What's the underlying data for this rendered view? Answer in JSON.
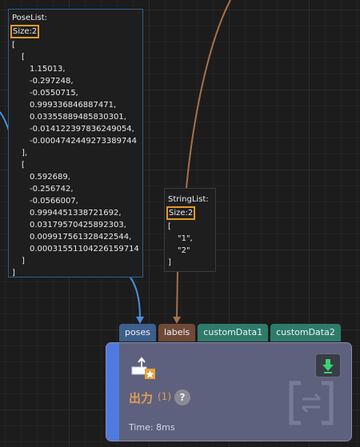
{
  "pose_tooltip": {
    "title": "PoseList:",
    "size": "Size:2",
    "lines": [
      {
        "text": "[",
        "level": 0
      },
      {
        "text": "[",
        "level": 1
      },
      {
        "text": "1.15013,",
        "level": 2
      },
      {
        "text": "-0.297248,",
        "level": 2
      },
      {
        "text": "-0.0550715,",
        "level": 2
      },
      {
        "text": "0.999336846887471,",
        "level": 2
      },
      {
        "text": "0.03355889485830301,",
        "level": 2
      },
      {
        "text": "-0.014122397836249054,",
        "level": 2
      },
      {
        "text": "-0.0004742449273389744",
        "level": 2
      },
      {
        "text": "],",
        "level": 1
      },
      {
        "text": "[",
        "level": 1
      },
      {
        "text": "0.592689,",
        "level": 2
      },
      {
        "text": "-0.256742,",
        "level": 2
      },
      {
        "text": "-0.0566007,",
        "level": 2
      },
      {
        "text": "0.9994451338721692,",
        "level": 2
      },
      {
        "text": "0.03179570425892303,",
        "level": 2
      },
      {
        "text": "0.009917561328422544,",
        "level": 2
      },
      {
        "text": "0.00031551104226159714",
        "level": 2
      },
      {
        "text": "]",
        "level": 1
      },
      {
        "text": "]",
        "level": 0
      }
    ]
  },
  "string_tooltip": {
    "title": "StringList:",
    "size": "Size:2",
    "lines": [
      {
        "text": "[",
        "level": 0
      },
      {
        "text": "\"1\",",
        "level": 3
      },
      {
        "text": "\"2\"",
        "level": 3
      },
      {
        "text": "]",
        "level": 0
      }
    ]
  },
  "ports": [
    {
      "label": "poses",
      "color": "#3d5f8c",
      "name": "port-poses"
    },
    {
      "label": "labels",
      "color": "#6e4a37",
      "name": "port-labels"
    },
    {
      "label": "customData1",
      "color": "#2e7b69",
      "name": "port-customdata1"
    },
    {
      "label": "customData2",
      "color": "#2e7b69",
      "name": "port-customdata2"
    }
  ],
  "node": {
    "name": "出力",
    "count": "(1)",
    "help": "?",
    "time": "Time: 8ms",
    "icon": "output-step-icon",
    "out_icon": "download-arrow-icon"
  },
  "colors": {
    "pose_wire": "#4a8fe0",
    "label_wire": "#a8704a",
    "size_highlight": "#e39a2a",
    "step_name": "#e39a55",
    "node_body": "#5e617d",
    "node_stripe": "#4f7be0"
  }
}
